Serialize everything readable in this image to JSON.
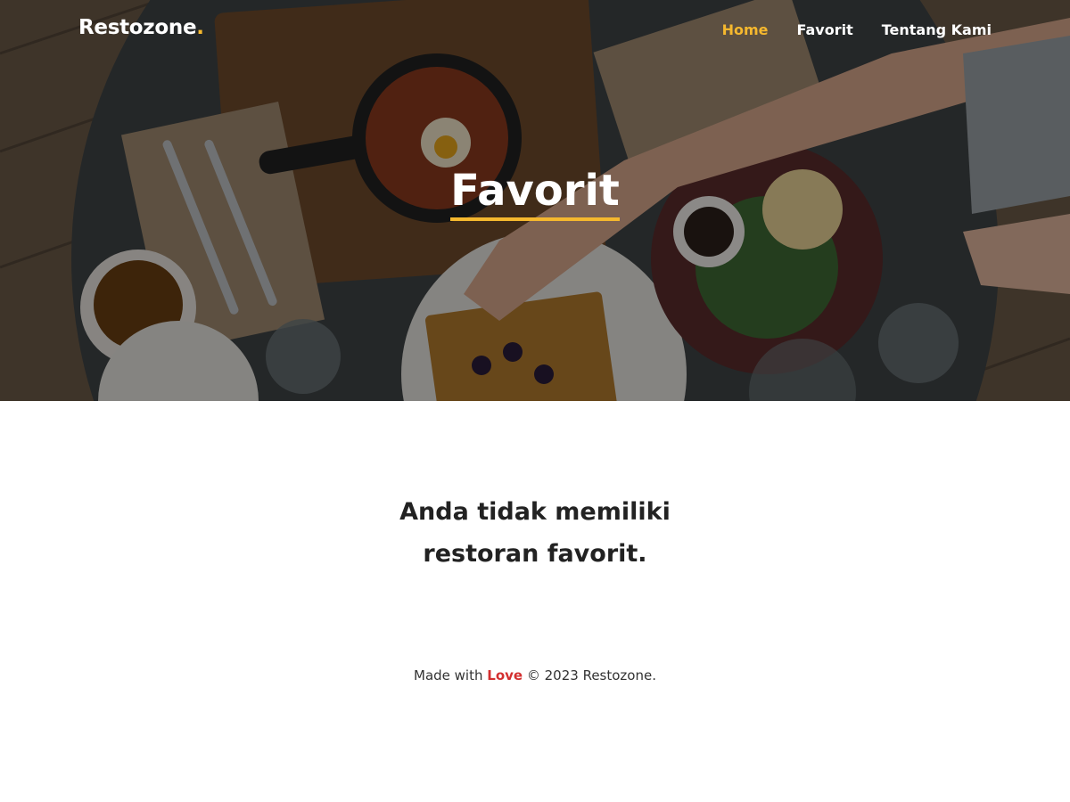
{
  "colors": {
    "accent": "#f5b82e",
    "love": "#d32f2f",
    "text": "#222222"
  },
  "header": {
    "brand": "Restozone",
    "brand_dot": ".",
    "nav": [
      {
        "label": "Home",
        "active": true
      },
      {
        "label": "Favorit",
        "active": false
      },
      {
        "label": "Tentang Kami",
        "active": false
      }
    ]
  },
  "hero": {
    "title": "Favorit",
    "image": "restaurant-table-food-photo"
  },
  "main": {
    "empty_line_1": "Anda tidak memiliki",
    "empty_line_2": "restoran favorit."
  },
  "footer": {
    "made_with": "Made with",
    "love": "Love",
    "copyright": "© 2023 Restozone."
  }
}
